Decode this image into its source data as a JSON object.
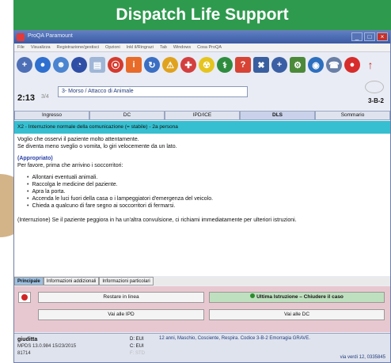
{
  "banner": {
    "title": "Dispatch Life Support"
  },
  "window": {
    "title": "ProQA Paramount",
    "controls": [
      "_",
      "□",
      "×"
    ]
  },
  "menu": [
    "File",
    "Visualizza",
    "Registrazione/gestisci",
    "Opzioni",
    "Inkl il/Ringrazi",
    "Tab",
    "Windows",
    "Cosa ProQA"
  ],
  "toolbar": {
    "icons": [
      {
        "name": "new-case-icon",
        "glyph": "+",
        "color": "#4d6fb6",
        "shape": "circle"
      },
      {
        "name": "stop-icon",
        "glyph": "●",
        "color": "#2f6fcf",
        "shape": "circle"
      },
      {
        "name": "user-icon",
        "glyph": "☻",
        "color": "#4b84d0",
        "shape": "circle"
      },
      {
        "name": "timer-icon",
        "glyph": "◔",
        "color": "#2f4fa6",
        "shape": "circle"
      },
      {
        "name": "document-icon",
        "glyph": "▤",
        "color": "#9fb6d6",
        "shape": "square"
      },
      {
        "name": "alert-icon",
        "glyph": "⦿",
        "color": "#d53a2e",
        "shape": "circle"
      },
      {
        "name": "info-icon",
        "glyph": "i",
        "color": "#e86b2a",
        "shape": "square"
      },
      {
        "name": "cycle-icon",
        "glyph": "↻",
        "color": "#3b6fc3",
        "shape": "circle"
      },
      {
        "name": "warning-icon",
        "glyph": "⚠",
        "color": "#e0a21e",
        "shape": "circle"
      },
      {
        "name": "cardio-icon",
        "glyph": "✚",
        "color": "#d33f3f",
        "shape": "circle"
      },
      {
        "name": "hazard-icon",
        "glyph": "☢",
        "color": "#e6c41f",
        "shape": "circle"
      },
      {
        "name": "medic-icon",
        "glyph": "⚕",
        "color": "#2f8c3f",
        "shape": "circle"
      },
      {
        "name": "help-icon",
        "glyph": "?",
        "color": "#d74435",
        "shape": "square"
      },
      {
        "name": "cross-icon",
        "glyph": "✖",
        "color": "#3a5fa0",
        "shape": "square"
      },
      {
        "name": "plus-icon",
        "glyph": "+",
        "color": "#3b5fa5",
        "shape": "circle"
      },
      {
        "name": "settings-icon",
        "glyph": "⚙",
        "color": "#4c8a3a",
        "shape": "square"
      },
      {
        "name": "globe-icon",
        "glyph": "◉",
        "color": "#2d6fbf",
        "shape": "circle"
      },
      {
        "name": "contacts-icon",
        "glyph": "☎",
        "color": "#6a7fa6",
        "shape": "circle"
      },
      {
        "name": "record-icon",
        "glyph": "●",
        "color": "#d72c2c",
        "shape": "circle"
      },
      {
        "name": "exit-icon",
        "glyph": "↑",
        "color": "transparent",
        "shape": "plain"
      }
    ]
  },
  "caseinfo": {
    "timer": "2:13",
    "timer_sub": "3/4",
    "protocol": "3- Morso / Attacco di Animale",
    "code": "3-B-2"
  },
  "tabs": [
    {
      "label": "Ingresso",
      "active": false
    },
    {
      "label": "DC",
      "active": false
    },
    {
      "label": "IPD/ICE",
      "active": false
    },
    {
      "label": "DLS",
      "active": true
    },
    {
      "label": "Sommario",
      "active": false
    }
  ],
  "section": {
    "title": "X2 - Interruzione normale della comunicazione (= stabile) - 2a persona"
  },
  "content": {
    "intro1": "Voglio che osservi il paziente molto attentamente.",
    "intro2": "Se diventa meno sveglio o vomita, lo giri velocemente da un lato.",
    "subheading": "(Appropriato)",
    "please": "Per favore, prima che arrivino i soccorritori:",
    "bullets": [
      "Allontani eventuali animali.",
      "Raccolga le medicine del paziente.",
      "Apra la porta.",
      "Accenda le luci fuori della casa o i lampeggiatori d'emergenza del veicolo.",
      "Chieda a qualcuno di fare segno ai soccorritori di fermarsi."
    ],
    "intervene": "(Interruzione) Se il paziente peggiora in ha un'altra convulsione, ci richiami immediatamente per ulteriori istruzioni."
  },
  "bottom_tabs": [
    {
      "label": "Principale",
      "active": true
    },
    {
      "label": "Informazioni addizionali",
      "active": false
    },
    {
      "label": "Informazioni particolari",
      "active": false
    }
  ],
  "actions": {
    "restore": "Restare in linea",
    "last": "Ultima Istruzione – Chiudere il caso",
    "go_ipd": "Vai alle IPD",
    "go_dc": "Vai alle DC"
  },
  "status": {
    "user": "giuditta",
    "meta": "MPDS 13.0.984 15/23/2015",
    "id": "81714",
    "d_lines": [
      "D: EUI",
      "C: EUI",
      "F: STD"
    ],
    "description": "12 anni, Maschio, Cosciente, Respira. Codice 3-B-2 Emorragia GRAVE.",
    "address": "via verdi 12, 0335845"
  }
}
